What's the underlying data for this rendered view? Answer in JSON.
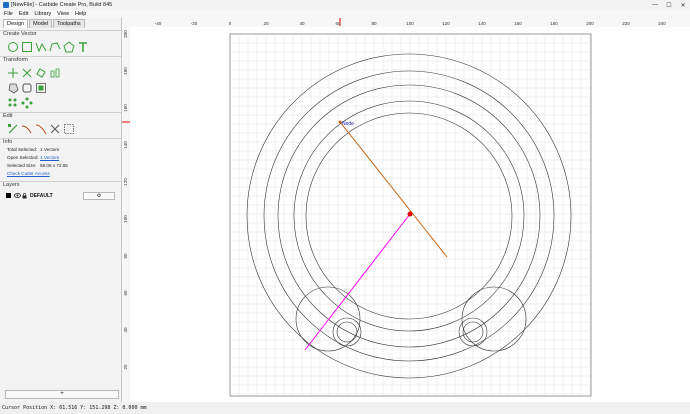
{
  "window": {
    "title": "[NewFile] - Carbide Create Pro, Build 845",
    "minimize": "—",
    "maximize": "☐",
    "close": "✕"
  },
  "menu": [
    "File",
    "Edit",
    "Library",
    "View",
    "Help"
  ],
  "sidebar": {
    "tabs": [
      "Design",
      "Model",
      "Toolpaths"
    ],
    "create_vector": "Create Vector",
    "transform": "Transform",
    "edit": "Edit",
    "info": {
      "title": "Info",
      "total_selected_label": "Total Selected:",
      "total_selected_value": "1 Vectors",
      "open_selected_label": "Open Selected:",
      "open_selected_value": "1 Vectors",
      "selected_size_label": "Selected Size:",
      "selected_size_value": "58.06 x 73.85",
      "check_cutter_access": "Check Cutter Access"
    },
    "layers": {
      "title": "Layers",
      "items": [
        {
          "name": "DEFAULT",
          "color": "#000000"
        }
      ],
      "gear": "⚙",
      "add": "+"
    }
  },
  "ruler": {
    "x_labels": [
      "-40",
      "-20",
      "0",
      "20",
      "40",
      "60",
      "80",
      "100",
      "120",
      "140",
      "160",
      "180",
      "200",
      "220",
      "240"
    ],
    "y_labels": [
      "200",
      "180",
      "160",
      "140",
      "120",
      "100",
      "80",
      "60",
      "40",
      "20"
    ]
  },
  "canvas": {
    "node_label": "Node",
    "colors": {
      "selected_path": "#c8661a",
      "helper_line": "#ff00ff",
      "vectors": "#333333",
      "node": "#e00000",
      "node_label": "#2020c0"
    }
  },
  "status": {
    "cursor_position": "Cursor Position X: 61.516 Y: 151.298 Z: 0.000 mm"
  }
}
